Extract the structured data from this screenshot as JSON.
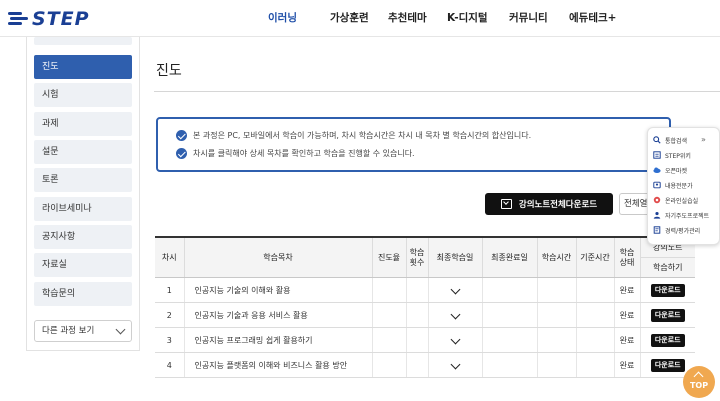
{
  "logo": {
    "text": "STEP"
  },
  "gnb": [
    "이러닝",
    "가상훈련",
    "추천테마",
    "K-디지털",
    "커뮤니티",
    "에듀테크+"
  ],
  "sidebar": {
    "items": [
      "진도",
      "시험",
      "과제",
      "설문",
      "토론",
      "라이브세미나",
      "공지사항",
      "자료실",
      "학습문의"
    ],
    "select_label": "다른 과정 보기"
  },
  "main": {
    "title": "진도",
    "notices": [
      "본 과정은 PC, 모바일에서 학습이 가능하며, 차시 학습시간은 차시 내 목차 별 학습시간의 합산입니다.",
      "차시를 클릭해야 상세 목차를 확인하고 학습을 진행할 수 있습니다."
    ],
    "download_all_label": "강의노트전체다운로드",
    "full_label": "전체열기"
  },
  "table": {
    "headers": [
      "차시",
      "학습목차",
      "진도율",
      "학습\n횟수",
      "최종학습일",
      "최종완료일",
      "학습시간",
      "기준시간",
      "학습\n상태",
      "강의노트",
      "학습하기"
    ],
    "rows": [
      {
        "no": "1",
        "title": "인공지능 기술의 이해와 활용",
        "status": "완료",
        "dl": "다운로드"
      },
      {
        "no": "2",
        "title": "인공지능 기술과 응용 서비스 활용",
        "status": "완료",
        "dl": "다운로드"
      },
      {
        "no": "3",
        "title": "인공지능 프로그래밍 쉽게 활용하기",
        "status": "완료",
        "dl": "다운로드"
      },
      {
        "no": "4",
        "title": "인공지능 플랫폼의 이해와 비즈니스 활용 방안",
        "status": "완료",
        "dl": "다운로드"
      }
    ]
  },
  "quick_menu": {
    "close": "»",
    "items": [
      {
        "label": "통합검색",
        "icon": "search-icon"
      },
      {
        "label": "STEP위키",
        "icon": "wiki-icon"
      },
      {
        "label": "오픈마켓",
        "icon": "cloud-icon"
      },
      {
        "label": "내용전문가",
        "icon": "expert-icon"
      },
      {
        "label": "온라인실습실",
        "icon": "lab-icon"
      },
      {
        "label": "자기주도프로젝트",
        "icon": "project-icon"
      },
      {
        "label": "경력/평가관리",
        "icon": "career-icon"
      }
    ]
  },
  "top_button": {
    "label": "TOP"
  },
  "colors": {
    "brand": "#1a3f94",
    "accent": "#2f5fae",
    "top": "#f0a850"
  }
}
